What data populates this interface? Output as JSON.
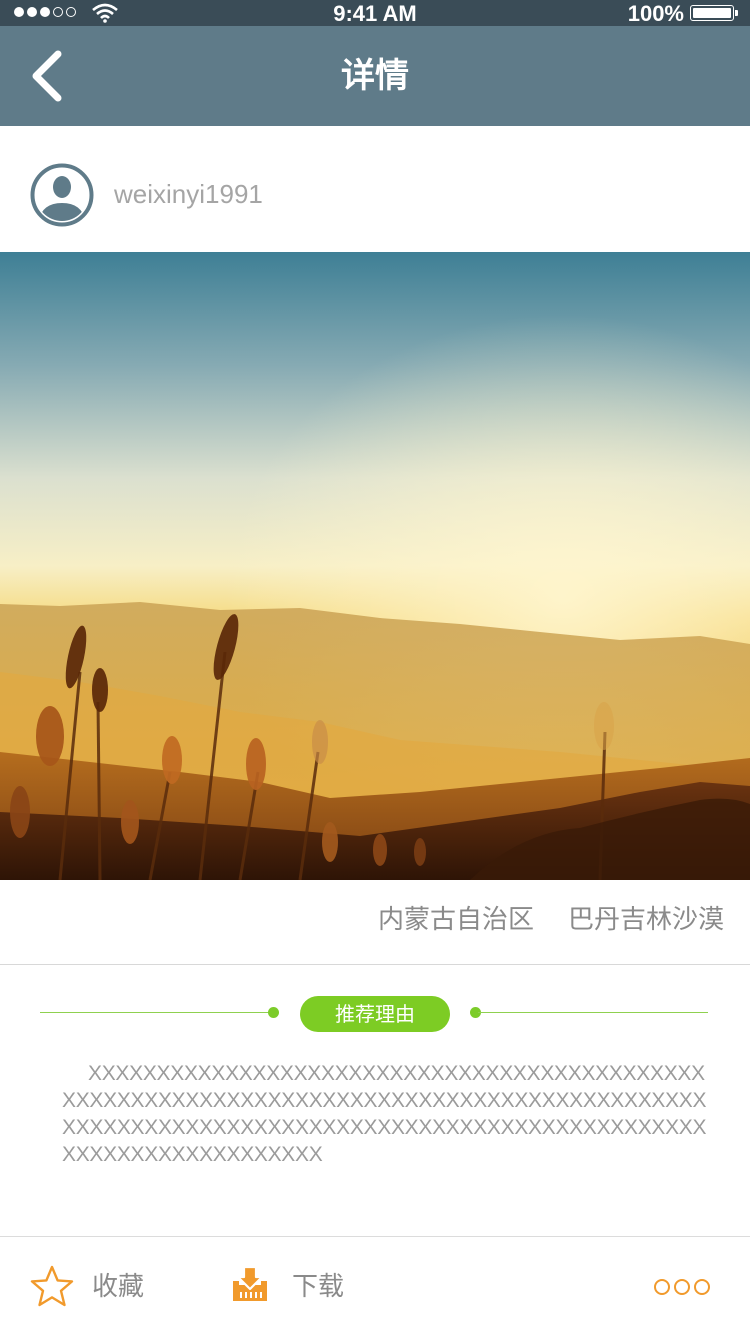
{
  "status_bar": {
    "time": "9:41 AM",
    "battery": "100%",
    "icons": [
      "signal-icon",
      "wifi-icon",
      "battery-icon"
    ]
  },
  "nav": {
    "title": "详情",
    "back_icon": "chevron-left-icon"
  },
  "user": {
    "username": "weixinyi1991",
    "avatar_icon": "user-avatar-icon"
  },
  "location": {
    "region": "内蒙古自治区",
    "place": "巴丹吉林沙漠"
  },
  "recommendation": {
    "title": "推荐理由",
    "text": "XXXXXXXXXXXXXXXXXXXXXXXXXXXXXXXXXXXXXXXXXXXXXXXXXXXXXXXXXXXXXXXXXXXXXXXXXXXXXXXXXXXXXXXXXXXXXXXXXXXXXXXXXXXXXXXXXXXXXXXXXXXXXXXXXXXXXXXXXXXXXXXXXXXXXXXXXXXXXX"
  },
  "toolbar": {
    "favorite_label": "收藏",
    "download_label": "下载",
    "favorite_icon": "star-icon",
    "download_icon": "download-icon",
    "more_icon": "more-icon"
  },
  "colors": {
    "nav_bg": "#5f7b89",
    "accent_green": "#7dcc24",
    "accent_orange": "#f19a2c"
  }
}
